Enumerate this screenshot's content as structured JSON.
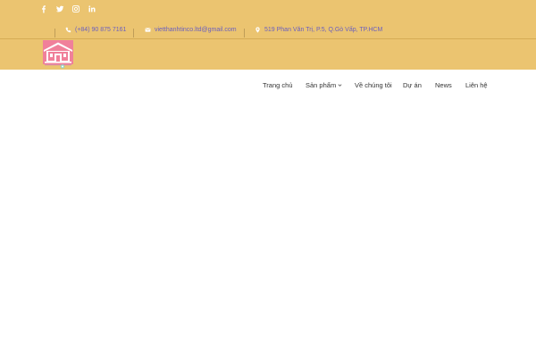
{
  "colors": {
    "topbar": "#ebc470",
    "contact_text": "#6a5fbf",
    "nav_text": "#333333",
    "page": "#ffffff"
  },
  "social": {
    "icons": [
      "facebook-icon",
      "twitter-icon",
      "instagram-icon",
      "linkedin-icon"
    ]
  },
  "contact": {
    "phone": "(+84) 90 875 7161",
    "email": "vietthanhtinco.ltd@gmail.com",
    "address": "519 Phan Văn Trị, P.5, Q.Gò Vấp, TP.HCM"
  },
  "nav": {
    "items": [
      {
        "label": "Trang chủ"
      },
      {
        "label": "Sản phẩm",
        "has_dropdown": true
      },
      {
        "label": "Về chúng tôi"
      },
      {
        "label": "Dự án"
      },
      {
        "label": "News"
      },
      {
        "label": "Liên hệ"
      }
    ]
  },
  "logo": {
    "icon": "house-logo-icon"
  }
}
